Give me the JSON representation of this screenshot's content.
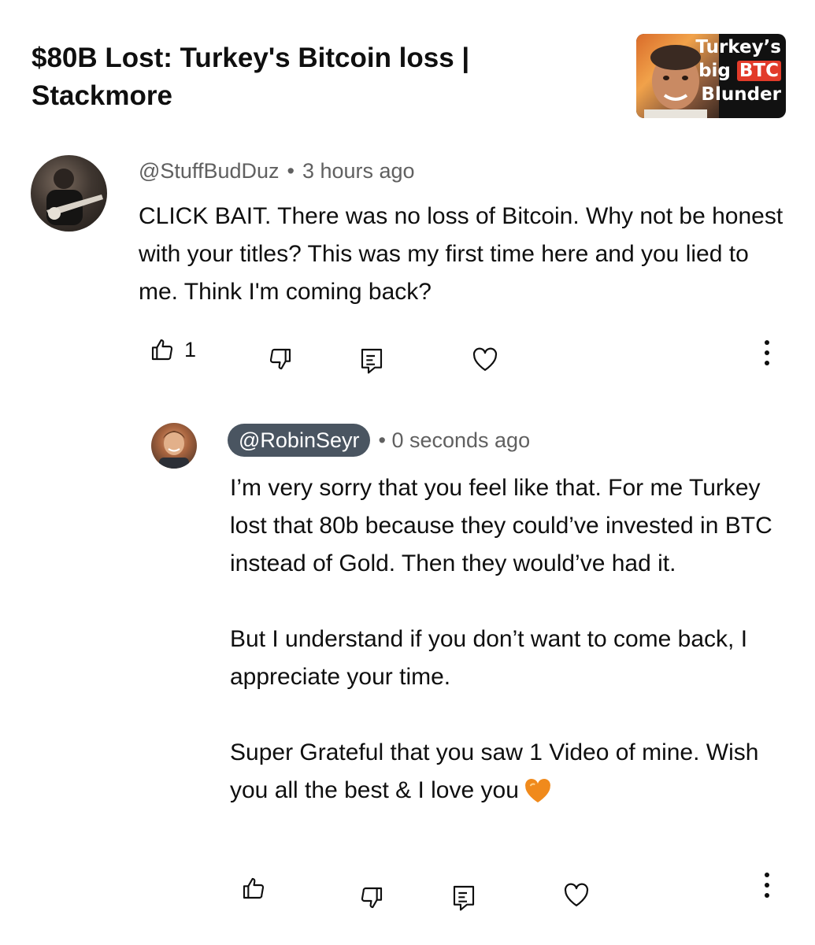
{
  "video": {
    "title": "$80B Lost: Turkey's Bitcoin loss | Stackmore",
    "thumbnail_text": {
      "line1": "Turkey’s",
      "line2_prefix": "big",
      "line2_highlight": "BTC",
      "line3": "Blunder"
    }
  },
  "comment": {
    "author": "@StuffBudDuz",
    "separator": "•",
    "time": "3 hours ago",
    "text": "CLICK BAIT. There was no loss of Bitcoin. Why not be honest with your titles? This was my first time here and you lied to me. Think I'm coming back?",
    "like_count": "1"
  },
  "reply": {
    "author": "@RobinSeyr",
    "separator": "•",
    "time": "0 seconds ago",
    "paragraph1": "I’m very sorry that you feel like that. For me Turkey lost that 80b because they could’ve invested in BTC instead of Gold. Then they would’ve had it.",
    "paragraph2": "But I understand if you don’t want to come back, I appreciate your time.",
    "paragraph3": "Super Grateful that you saw 1 Video of mine. Wish you all the best & I love you",
    "emoji": "orange-heart-emoji"
  },
  "icons": {
    "like": "thumbs-up-icon",
    "dislike": "thumbs-down-icon",
    "reply": "reply-icon",
    "heart": "heart-icon",
    "more": "more-vertical-icon"
  },
  "colors": {
    "owner_pill": "#4a5561",
    "meta_text": "#606060",
    "emoji_heart": "#f08a1c",
    "thumbnail_btc": "#e23b2a"
  }
}
